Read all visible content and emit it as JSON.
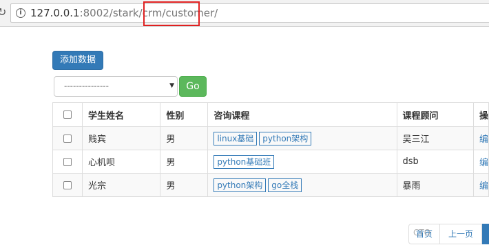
{
  "browser": {
    "url_host": "127.0.0.1",
    "url_rest": ":8002/stark/crm/customer/"
  },
  "toolbar": {
    "add_label": "添加数据",
    "select_value": "---------------",
    "go_label": "Go"
  },
  "table": {
    "headers": [
      "学生姓名",
      "性别",
      "咨询课程",
      "课程顾问",
      "操"
    ],
    "rows": [
      {
        "name": "贱宾",
        "gender": "男",
        "courses": [
          "linux基础",
          "python架构"
        ],
        "consultant": "吴三江",
        "op": "编"
      },
      {
        "name": "心机呗",
        "gender": "男",
        "courses": [
          "python基础班"
        ],
        "consultant": "dsb",
        "op": "编"
      },
      {
        "name": "光宗",
        "gender": "男",
        "courses": [
          "python架构",
          "go全栈"
        ],
        "consultant": "暴雨",
        "op": "编"
      }
    ]
  },
  "pagination": {
    "first_label": "首页",
    "prev_label": "上一页"
  },
  "watermark": "CTO"
}
